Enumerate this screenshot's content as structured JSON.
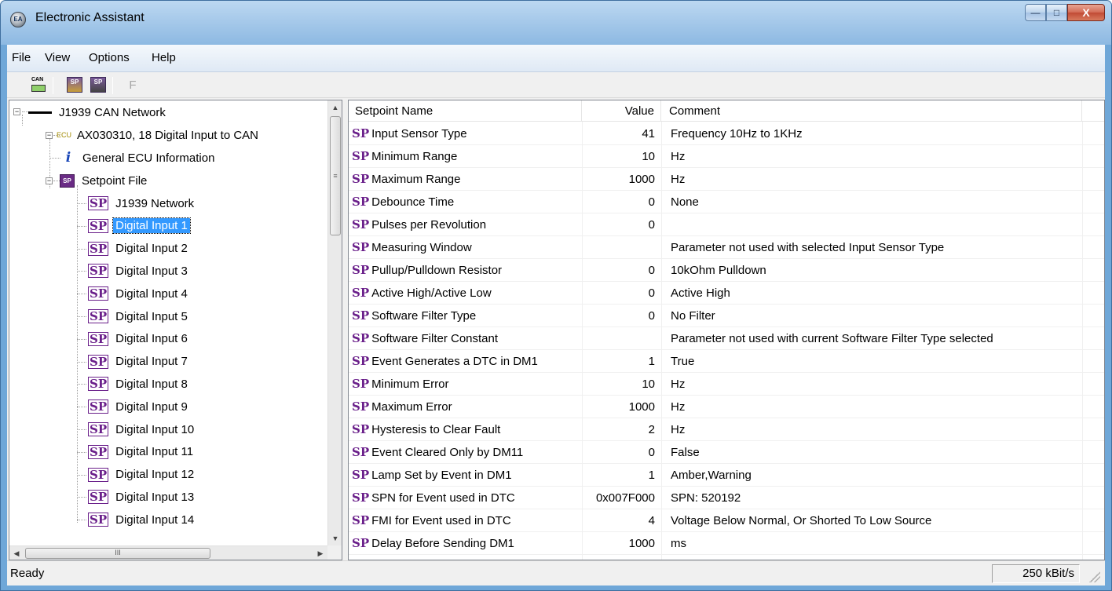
{
  "window": {
    "title": "Electronic Assistant",
    "icon_label": "EA",
    "controls": {
      "minimize": "—",
      "maximize": "□",
      "close": "X"
    }
  },
  "menu": [
    "File",
    "View",
    "Options",
    "Help"
  ],
  "toolbar": {
    "can_icon_label": "CAN",
    "sp_open_label": "SP",
    "sp_save_label": "SP",
    "f_label": "F"
  },
  "tree": {
    "network": "J1939 CAN Network",
    "ecu_icon_label": "ECU",
    "ecu": "AX030310, 18 Digital Input to CAN",
    "general_info": "General ECU Information",
    "info_icon_label": "i",
    "setpoint_file": "Setpoint File",
    "spfile_icon_label": "SP",
    "sp_icon_label": "SP",
    "items": [
      "J1939 Network",
      "Digital Input 1",
      "Digital Input 2",
      "Digital Input 3",
      "Digital Input 4",
      "Digital Input 5",
      "Digital Input 6",
      "Digital Input 7",
      "Digital Input 8",
      "Digital Input 9",
      "Digital Input 10",
      "Digital Input 11",
      "Digital Input 12",
      "Digital Input 13",
      "Digital Input 14"
    ],
    "selected_index": 1,
    "expander_minus": "−",
    "scroll_up": "▲",
    "scroll_down": "▼",
    "scroll_left": "◀",
    "scroll_right": "▶",
    "hthumb_grip": "III",
    "vthumb_grip": "≡"
  },
  "table": {
    "columns": {
      "name": "Setpoint Name",
      "value": "Value",
      "comment": "Comment"
    },
    "sp_tag": "SP",
    "rows": [
      {
        "name": "Input Sensor Type",
        "value": "41",
        "comment": "Frequency 10Hz to 1KHz"
      },
      {
        "name": "Minimum Range",
        "value": "10",
        "comment": "Hz"
      },
      {
        "name": "Maximum Range",
        "value": "1000",
        "comment": "Hz"
      },
      {
        "name": "Debounce Time",
        "value": "0",
        "comment": "None"
      },
      {
        "name": "Pulses per Revolution",
        "value": "0",
        "comment": ""
      },
      {
        "name": "Measuring Window",
        "value": "",
        "comment": "Parameter not used with selected Input Sensor Type"
      },
      {
        "name": "Pullup/Pulldown Resistor",
        "value": "0",
        "comment": "10kOhm Pulldown"
      },
      {
        "name": "Active High/Active Low",
        "value": "0",
        "comment": "Active High"
      },
      {
        "name": "Software Filter Type",
        "value": "0",
        "comment": "No Filter"
      },
      {
        "name": "Software Filter Constant",
        "value": "",
        "comment": "Parameter not used with current Software Filter Type selected"
      },
      {
        "name": "Event Generates a DTC in DM1",
        "value": "1",
        "comment": "True"
      },
      {
        "name": "Minimum Error",
        "value": "10",
        "comment": "Hz"
      },
      {
        "name": "Maximum Error",
        "value": "1000",
        "comment": "Hz"
      },
      {
        "name": "Hysteresis to Clear Fault",
        "value": "2",
        "comment": "Hz"
      },
      {
        "name": "Event Cleared Only by DM11",
        "value": "0",
        "comment": "False"
      },
      {
        "name": "Lamp Set by Event in DM1",
        "value": "1",
        "comment": "Amber,Warning"
      },
      {
        "name": "SPN for Event used in DTC",
        "value": "0x007F000",
        "comment": "SPN: 520192"
      },
      {
        "name": "FMI for Event used in DTC",
        "value": "4",
        "comment": "Voltage Below Normal, Or Shorted To Low Source"
      },
      {
        "name": "Delay Before Sending DM1",
        "value": "1000",
        "comment": "ms"
      }
    ]
  },
  "status": {
    "text": "Ready",
    "bitrate": "250 kBit/s"
  },
  "colors": {
    "selection": "#3399ff",
    "sp_purple": "#6a1f8a",
    "title_blue": "#a9cbeb"
  }
}
